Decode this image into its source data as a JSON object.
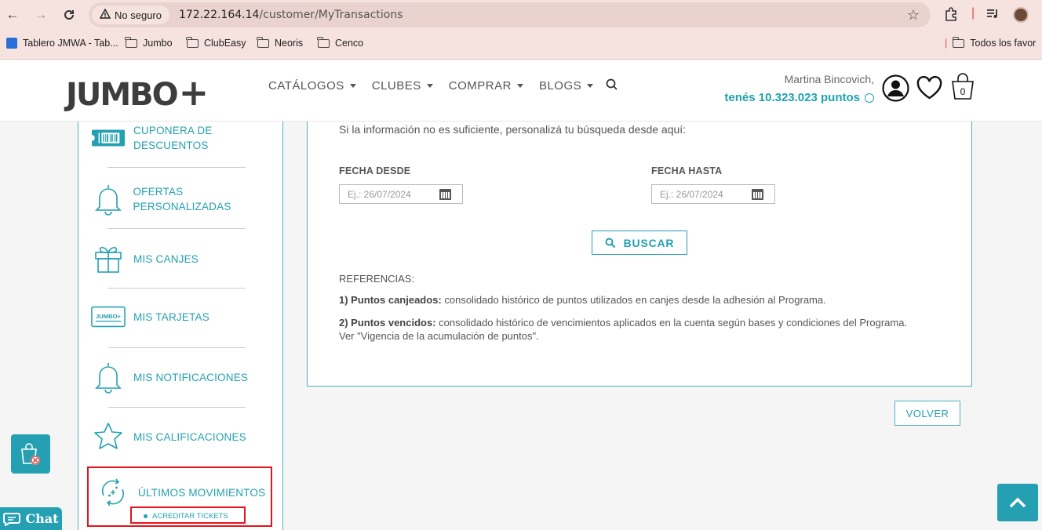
{
  "browser": {
    "security_label": "No seguro",
    "url_host": "172.22.164.14",
    "url_path": "/customer/MyTransactions",
    "bookmarks": [
      "Tablero JMWA - Tab...",
      "Jumbo",
      "ClubEasy",
      "Neoris",
      "Cenco"
    ],
    "all_bookmarks": "Todos los favor"
  },
  "header": {
    "logo": "JUMBO",
    "logo_plus": "+",
    "menu": [
      "CATÁLOGOS",
      "CLUBES",
      "COMPRAR",
      "BLOGS"
    ],
    "greeting": "Martina Bincovich,",
    "points": "tenés 10.323.023 puntos",
    "cart_count": "0",
    "accent_color": "#25a0b2"
  },
  "sidebar": {
    "items": [
      {
        "label_line1": "CUPONERA DE",
        "label_line2": "DESCUENTOS",
        "icon": "coupon-icon"
      },
      {
        "label": "OFERTAS PERSONALIZADAS",
        "icon": "bell-icon"
      },
      {
        "label": "MIS CANJES",
        "icon": "gift-icon"
      },
      {
        "label": "MIS TARJETAS",
        "icon": "card-icon",
        "card_text": "JUMBO+"
      },
      {
        "label": "MIS NOTIFICACIONES",
        "icon": "bell-icon"
      },
      {
        "label": "MIS CALIFICACIONES",
        "icon": "star-icon"
      },
      {
        "label": "ÚLTIMOS MOVIMIENTOS",
        "icon": "refresh-points-icon"
      }
    ],
    "sub_item": "ACREDITAR TICKETS"
  },
  "search_panel": {
    "intro": "Si la información no es suficiente, personalizá tu búsqueda desde aquí:",
    "from_label": "FECHA DESDE",
    "from_placeholder": "Ej.: 26/07/2024",
    "to_label": "FECHA HASTA",
    "to_placeholder": "Ej.: 26/07/2024",
    "search_button": "BUSCAR",
    "refs_title": "REFERENCIAS:",
    "ref1_bold": "1) Puntos canjeados:",
    "ref1_text": " consolidado histórico de puntos utilizados en canjes desde la adhesión al Programa.",
    "ref2_bold": "2) Puntos vencidos:",
    "ref2_text": " consolidado histórico de vencimientos aplicados en la cuenta según bases y condiciones del Programa.",
    "ref2_line2": "Ver \"Vigencia de la acumulación de puntos\"."
  },
  "back_button": "VOLVER",
  "chat_label": "Chat"
}
